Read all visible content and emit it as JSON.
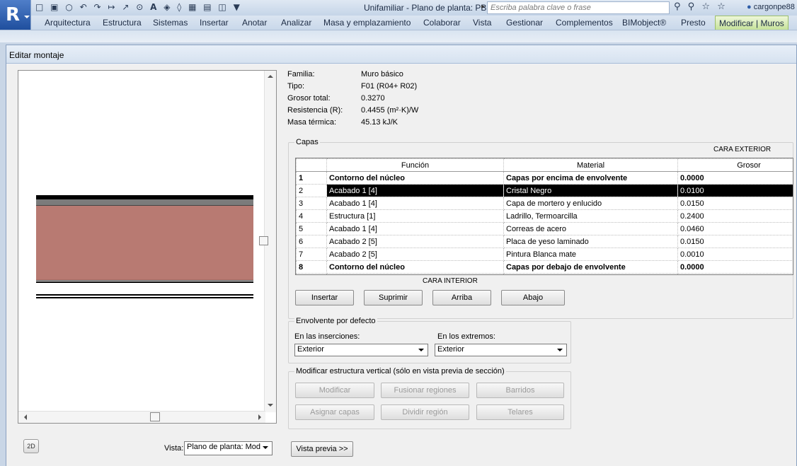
{
  "titlebar": {
    "document_title": "Unifamiliar - Plano de planta: PB Inf (NSR PB)",
    "search_placeholder": "Escriba palabra clave o frase",
    "user_name": "cargonpe88",
    "app_icon_letter": "R"
  },
  "ribbon_tabs": [
    {
      "label": "Arquitectura"
    },
    {
      "label": "Estructura"
    },
    {
      "label": "Sistemas"
    },
    {
      "label": "Insertar"
    },
    {
      "label": "Anotar"
    },
    {
      "label": "Analizar"
    },
    {
      "label": "Masa y emplazamiento"
    },
    {
      "label": "Colaborar"
    },
    {
      "label": "Vista"
    },
    {
      "label": "Gestionar"
    },
    {
      "label": "Complementos"
    },
    {
      "label": "BIMobject®"
    },
    {
      "label": "Presto"
    },
    {
      "label": "Modificar | Muros"
    }
  ],
  "dialog": {
    "title": "Editar montaje",
    "info": {
      "familia_label": "Familia:",
      "familia_value": "Muro básico",
      "tipo_label": "Tipo:",
      "tipo_value": "F01 (R04+ R02)",
      "grosor_label": "Grosor total:",
      "grosor_value": "0.3270",
      "resistencia_label": "Resistencia (R):",
      "resistencia_value": "0.4455 (m²·K)/W",
      "masa_label": "Masa térmica:",
      "masa_value": "45.13 kJ/K"
    },
    "layers": {
      "group_title": "Capas",
      "exterior_label": "CARA EXTERIOR",
      "interior_label": "CARA INTERIOR",
      "headers": {
        "num": "",
        "funcion": "Función",
        "material": "Material",
        "grosor": "Grosor"
      },
      "rows": [
        {
          "num": "1",
          "funcion": "Contorno del núcleo",
          "material": "Capas por encima de envolvente",
          "grosor": "0.0000"
        },
        {
          "num": "2",
          "funcion": "Acabado 1 [4]",
          "material": "Cristal Negro",
          "grosor": "0.0100"
        },
        {
          "num": "3",
          "funcion": "Acabado 1 [4]",
          "material": "Capa de mortero y enlucido",
          "grosor": "0.0150"
        },
        {
          "num": "4",
          "funcion": "Estructura [1]",
          "material": "Ladrillo, Termoarcilla",
          "grosor": "0.2400"
        },
        {
          "num": "5",
          "funcion": "Acabado 1 [4]",
          "material": "Correas de acero",
          "grosor": "0.0460"
        },
        {
          "num": "6",
          "funcion": "Acabado 2 [5]",
          "material": "Placa de yeso laminado",
          "grosor": "0.0150"
        },
        {
          "num": "7",
          "funcion": "Acabado 2 [5]",
          "material": "Pintura Blanca mate",
          "grosor": "0.0010"
        },
        {
          "num": "8",
          "funcion": "Contorno del núcleo",
          "material": "Capas por debajo de envolvente",
          "grosor": "0.0000"
        }
      ],
      "buttons": {
        "insertar": "Insertar",
        "suprimir": "Suprimir",
        "arriba": "Arriba",
        "abajo": "Abajo"
      }
    },
    "envolvente": {
      "group_title": "Envolvente por defecto",
      "inserciones_label": "En las inserciones:",
      "inserciones_value": "Exterior",
      "extremos_label": "En los extremos:",
      "extremos_value": "Exterior"
    },
    "modificar": {
      "group_title": "Modificar estructura vertical (sólo en vista previa de sección)",
      "buttons": {
        "modificar": "Modificar",
        "fusionar": "Fusionar regiones",
        "barridos": "Barridos",
        "asignar": "Asignar capas",
        "dividir": "Dividir región",
        "telares": "Telares"
      }
    },
    "footer": {
      "vista_label": "Vista:",
      "vista_value": "Plano de planta: Mod",
      "preview_button": "Vista previa >>",
      "icon_text": "2D"
    }
  },
  "colors": {
    "selected_row_bg": "#000000",
    "wall_core": "#b87a72",
    "active_tab": "#c5e19a"
  }
}
